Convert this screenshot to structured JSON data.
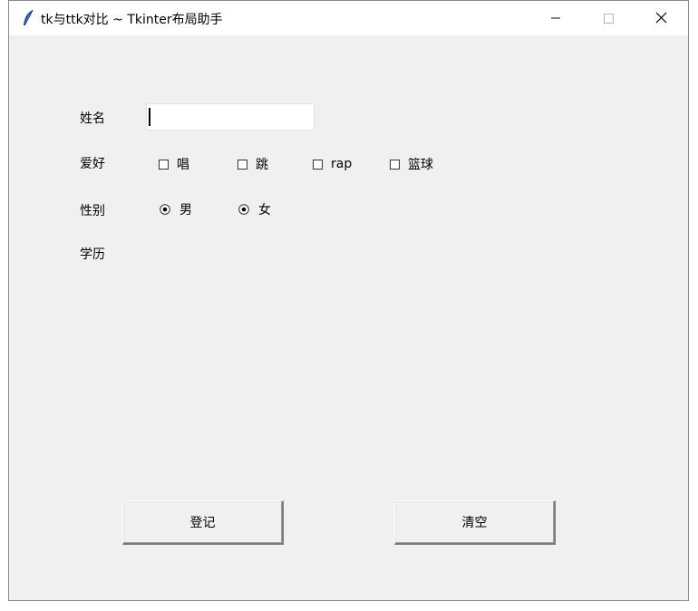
{
  "window": {
    "title": "tk与ttk对比 ~ Tkinter布局助手"
  },
  "form": {
    "name_label": "姓名",
    "name_value": "",
    "hobby_label": "爱好",
    "hobbies": [
      {
        "label": "唱",
        "checked": false
      },
      {
        "label": "跳",
        "checked": false
      },
      {
        "label": "rap",
        "checked": false
      },
      {
        "label": "篮球",
        "checked": false
      }
    ],
    "gender_label": "性别",
    "genders": [
      {
        "label": "男",
        "selected": true
      },
      {
        "label": "女",
        "selected": true
      }
    ],
    "education_label": "学历"
  },
  "buttons": {
    "register_label": "登记",
    "clear_label": "清空"
  }
}
